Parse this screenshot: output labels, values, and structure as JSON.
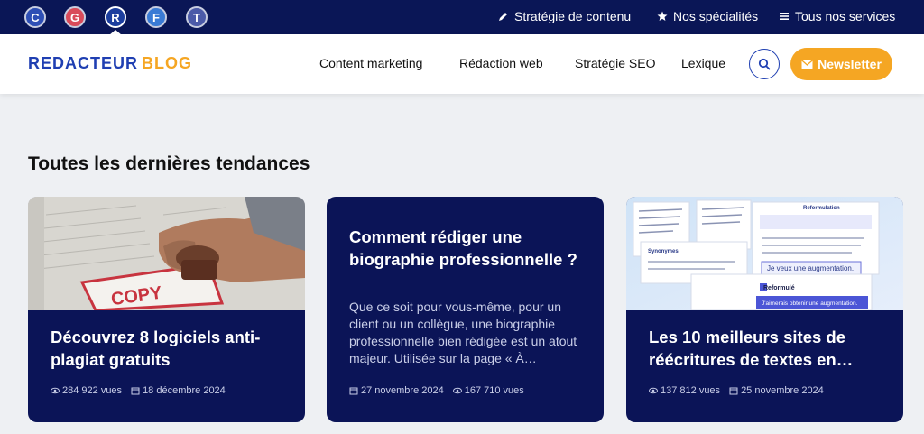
{
  "topbar": {
    "sites": [
      {
        "letter": "C",
        "color": "#2e4fb5"
      },
      {
        "letter": "G",
        "color": "#d94b5a"
      },
      {
        "letter": "R",
        "color": "#1c3e9e"
      },
      {
        "letter": "F",
        "color": "#3a7bd5"
      },
      {
        "letter": "T",
        "color": "#4b5aa8"
      }
    ],
    "links": [
      {
        "label": "Stratégie de contenu",
        "icon": "pen-icon"
      },
      {
        "label": "Nos spécialités",
        "icon": "star-icon"
      },
      {
        "label": "Tous nos services",
        "icon": "menu-icon"
      }
    ]
  },
  "header": {
    "logo_part1": "REDACTEUR",
    "logo_part2": "BLOG",
    "nav": [
      "Content marketing",
      "Rédaction web",
      "Stratégie SEO",
      "Lexique"
    ],
    "newsletter_label": "Newsletter"
  },
  "main": {
    "section_title": "Toutes les dernières tendances",
    "cards": [
      {
        "title": "Découvrez 8 logiciels anti-plagiat gratuits",
        "image_text": "COPY",
        "views": "284 922 vues",
        "date": "18 décembre 2024"
      },
      {
        "title": "Comment rédiger une biographie professionnelle ?",
        "excerpt": "Que ce soit pour vous-même, pour un client ou un collègue, une biographie professionnelle bien rédigée est un atout majeur. Utilisée sur la page « À…",
        "date": "27 novembre 2024",
        "views": "167 710 vues"
      },
      {
        "title": "Les 10 meilleurs sites de réécritures de textes en…",
        "image_text_1": "Reformulation",
        "image_text_2": "Je veux une augmentation.",
        "image_text_3": "Reformulé",
        "image_text_4": "J'aimerais obtenir une augmentation.",
        "image_text_5": "Synonymes",
        "views": "137 812 vues",
        "date": "25 novembre 2024"
      }
    ]
  },
  "colors": {
    "navy": "#0a1656",
    "card_bg": "#0b1457",
    "brand_blue": "#1f3fb2",
    "accent_orange": "#f5a623"
  }
}
